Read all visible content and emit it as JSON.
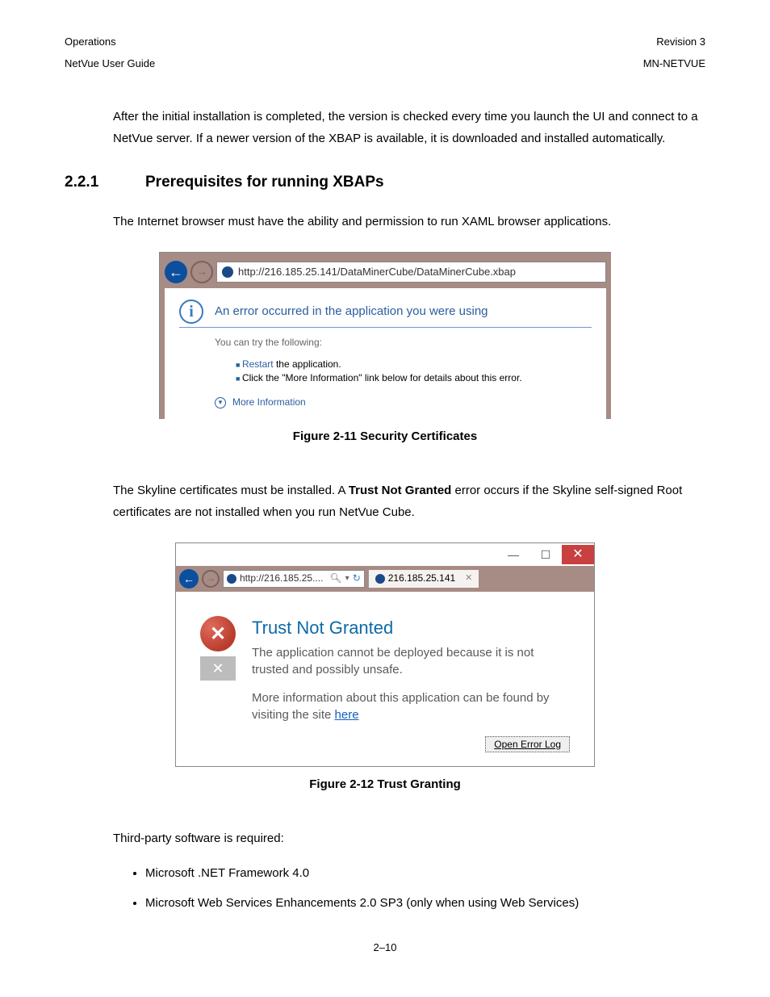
{
  "header": {
    "left_top": "Operations",
    "right_top": "Revision 3",
    "left_bottom": "NetVue User Guide",
    "right_bottom": "MN-NETVUE"
  },
  "intro_para": "After the initial installation is completed, the version is checked every time you launch the UI and connect to a NetVue server. If a newer version of the XBAP is available, it is downloaded and installed automatically.",
  "section": {
    "number": "2.2.1",
    "title": "Prerequisites for running XBAPs"
  },
  "prereq_para": "The Internet browser must have the ability and permission to run XAML browser applications.",
  "figure1": {
    "url": "http://216.185.25.141/DataMinerCube/DataMinerCube.xbap",
    "error_title": "An error occurred in the application you were using",
    "try_label": "You can try the following:",
    "bullet_restart_pre": "Restart",
    "bullet_restart_post": " the application.",
    "bullet_info": "Click the \"More Information\" link below for details about this error.",
    "more_info": "More Information",
    "caption": "Figure 2-11 Security Certificates"
  },
  "skyline_para_pre": "The Skyline certificates must be installed. A ",
  "skyline_bold": "Trust Not Granted",
  "skyline_para_post": " error occurs if the Skyline self-signed Root certificates are not installed when you run NetVue Cube.",
  "figure2": {
    "addr_text": "http://216.185.25....",
    "tab_text": "216.185.25.141",
    "title": "Trust Not Granted",
    "line1": "The application cannot be deployed because it is not trusted and possibly unsafe.",
    "line2_pre": "More information about this application can be found by visiting the site ",
    "here": "here",
    "open_err": "Open Error Log",
    "caption": "Figure 2-12 Trust Granting"
  },
  "third_party_label": "Third-party software is required:",
  "req1": "Microsoft .NET Framework 4.0",
  "req2": "Microsoft Web Services Enhancements 2.0 SP3 (only when using Web Services)",
  "page_num": "2–10"
}
